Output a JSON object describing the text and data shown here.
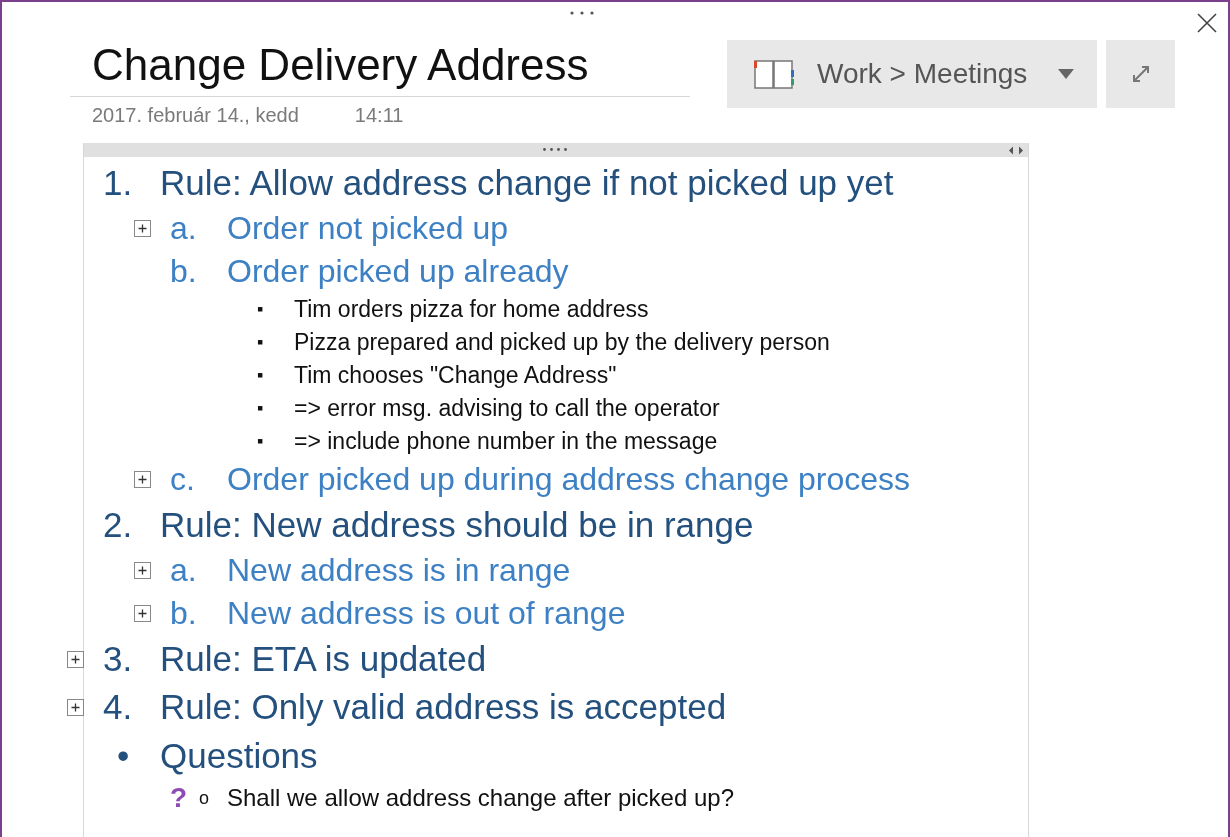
{
  "title": "Change Delivery Address",
  "date": "2017. február 14., kedd",
  "time": "14:11",
  "notebook": {
    "label": "Work > Meetings"
  },
  "outline": [
    {
      "kind": "numbered",
      "marker": "1.",
      "text": "Rule: Allow address change if not picked up yet",
      "collapsed": false,
      "children": [
        {
          "kind": "lettered",
          "marker": "a.",
          "text": "Order not picked up",
          "collapsed": true
        },
        {
          "kind": "lettered",
          "marker": "b.",
          "text": "Order picked up already",
          "collapsed": false,
          "children": [
            {
              "kind": "square",
              "marker": "▪",
              "text": "Tim orders pizza for home address",
              "collapsed": false
            },
            {
              "kind": "square",
              "marker": "▪",
              "text": "Pizza prepared and picked up by the delivery person",
              "collapsed": false
            },
            {
              "kind": "square",
              "marker": "▪",
              "text": "Tim chooses \"Change Address\"",
              "collapsed": false
            },
            {
              "kind": "square",
              "marker": "▪",
              "text": "=> error msg. advising to call the operator",
              "collapsed": false
            },
            {
              "kind": "square",
              "marker": "▪",
              "text": "=> include phone number in the message",
              "collapsed": false
            }
          ]
        },
        {
          "kind": "lettered",
          "marker": "c.",
          "text": "Order picked up during address change process",
          "collapsed": true
        }
      ]
    },
    {
      "kind": "numbered",
      "marker": "2.",
      "text": "Rule: New address should be in range",
      "collapsed": false,
      "children": [
        {
          "kind": "lettered",
          "marker": "a.",
          "text": "New address is in range",
          "collapsed": true
        },
        {
          "kind": "lettered",
          "marker": "b.",
          "text": "New address is out of range",
          "collapsed": true
        }
      ]
    },
    {
      "kind": "numbered",
      "marker": "3.",
      "text": "Rule: ETA is updated",
      "collapsed": true
    },
    {
      "kind": "numbered",
      "marker": "4.",
      "text": "Rule: Only valid address is accepted",
      "collapsed": true
    },
    {
      "kind": "bullet",
      "marker": "•",
      "text": "Questions",
      "collapsed": false,
      "children": [
        {
          "kind": "circle",
          "marker": "o",
          "tag": "?",
          "text": "Shall we allow address change after picked up?",
          "collapsed": false
        }
      ]
    }
  ]
}
